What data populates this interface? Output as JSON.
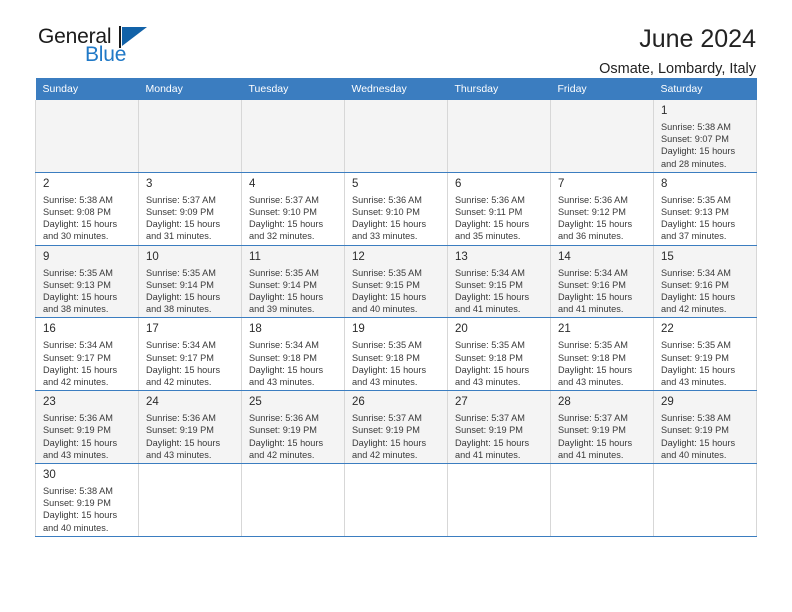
{
  "brand": {
    "name_part1": "General",
    "name_part2": "Blue",
    "flag_icon": "triangle-flag-icon",
    "accent_color": "#2079c7"
  },
  "header": {
    "title": "June 2024",
    "subtitle": "Osmate, Lombardy, Italy"
  },
  "calendar": {
    "header_bg": "#3b7dc0",
    "weekday_headers": [
      "Sunday",
      "Monday",
      "Tuesday",
      "Wednesday",
      "Thursday",
      "Friday",
      "Saturday"
    ],
    "weeks": [
      [
        {
          "day": "",
          "sunrise": "",
          "sunset": "",
          "daylight_line1": "",
          "daylight_line2": "",
          "empty": true
        },
        {
          "day": "",
          "sunrise": "",
          "sunset": "",
          "daylight_line1": "",
          "daylight_line2": "",
          "empty": true
        },
        {
          "day": "",
          "sunrise": "",
          "sunset": "",
          "daylight_line1": "",
          "daylight_line2": "",
          "empty": true
        },
        {
          "day": "",
          "sunrise": "",
          "sunset": "",
          "daylight_line1": "",
          "daylight_line2": "",
          "empty": true
        },
        {
          "day": "",
          "sunrise": "",
          "sunset": "",
          "daylight_line1": "",
          "daylight_line2": "",
          "empty": true
        },
        {
          "day": "",
          "sunrise": "",
          "sunset": "",
          "daylight_line1": "",
          "daylight_line2": "",
          "empty": true
        },
        {
          "day": "1",
          "sunrise": "Sunrise: 5:38 AM",
          "sunset": "Sunset: 9:07 PM",
          "daylight_line1": "Daylight: 15 hours",
          "daylight_line2": "and 28 minutes.",
          "empty": false
        }
      ],
      [
        {
          "day": "2",
          "sunrise": "Sunrise: 5:38 AM",
          "sunset": "Sunset: 9:08 PM",
          "daylight_line1": "Daylight: 15 hours",
          "daylight_line2": "and 30 minutes.",
          "empty": false
        },
        {
          "day": "3",
          "sunrise": "Sunrise: 5:37 AM",
          "sunset": "Sunset: 9:09 PM",
          "daylight_line1": "Daylight: 15 hours",
          "daylight_line2": "and 31 minutes.",
          "empty": false
        },
        {
          "day": "4",
          "sunrise": "Sunrise: 5:37 AM",
          "sunset": "Sunset: 9:10 PM",
          "daylight_line1": "Daylight: 15 hours",
          "daylight_line2": "and 32 minutes.",
          "empty": false
        },
        {
          "day": "5",
          "sunrise": "Sunrise: 5:36 AM",
          "sunset": "Sunset: 9:10 PM",
          "daylight_line1": "Daylight: 15 hours",
          "daylight_line2": "and 33 minutes.",
          "empty": false
        },
        {
          "day": "6",
          "sunrise": "Sunrise: 5:36 AM",
          "sunset": "Sunset: 9:11 PM",
          "daylight_line1": "Daylight: 15 hours",
          "daylight_line2": "and 35 minutes.",
          "empty": false
        },
        {
          "day": "7",
          "sunrise": "Sunrise: 5:36 AM",
          "sunset": "Sunset: 9:12 PM",
          "daylight_line1": "Daylight: 15 hours",
          "daylight_line2": "and 36 minutes.",
          "empty": false
        },
        {
          "day": "8",
          "sunrise": "Sunrise: 5:35 AM",
          "sunset": "Sunset: 9:13 PM",
          "daylight_line1": "Daylight: 15 hours",
          "daylight_line2": "and 37 minutes.",
          "empty": false
        }
      ],
      [
        {
          "day": "9",
          "sunrise": "Sunrise: 5:35 AM",
          "sunset": "Sunset: 9:13 PM",
          "daylight_line1": "Daylight: 15 hours",
          "daylight_line2": "and 38 minutes.",
          "empty": false
        },
        {
          "day": "10",
          "sunrise": "Sunrise: 5:35 AM",
          "sunset": "Sunset: 9:14 PM",
          "daylight_line1": "Daylight: 15 hours",
          "daylight_line2": "and 38 minutes.",
          "empty": false
        },
        {
          "day": "11",
          "sunrise": "Sunrise: 5:35 AM",
          "sunset": "Sunset: 9:14 PM",
          "daylight_line1": "Daylight: 15 hours",
          "daylight_line2": "and 39 minutes.",
          "empty": false
        },
        {
          "day": "12",
          "sunrise": "Sunrise: 5:35 AM",
          "sunset": "Sunset: 9:15 PM",
          "daylight_line1": "Daylight: 15 hours",
          "daylight_line2": "and 40 minutes.",
          "empty": false
        },
        {
          "day": "13",
          "sunrise": "Sunrise: 5:34 AM",
          "sunset": "Sunset: 9:15 PM",
          "daylight_line1": "Daylight: 15 hours",
          "daylight_line2": "and 41 minutes.",
          "empty": false
        },
        {
          "day": "14",
          "sunrise": "Sunrise: 5:34 AM",
          "sunset": "Sunset: 9:16 PM",
          "daylight_line1": "Daylight: 15 hours",
          "daylight_line2": "and 41 minutes.",
          "empty": false
        },
        {
          "day": "15",
          "sunrise": "Sunrise: 5:34 AM",
          "sunset": "Sunset: 9:16 PM",
          "daylight_line1": "Daylight: 15 hours",
          "daylight_line2": "and 42 minutes.",
          "empty": false
        }
      ],
      [
        {
          "day": "16",
          "sunrise": "Sunrise: 5:34 AM",
          "sunset": "Sunset: 9:17 PM",
          "daylight_line1": "Daylight: 15 hours",
          "daylight_line2": "and 42 minutes.",
          "empty": false
        },
        {
          "day": "17",
          "sunrise": "Sunrise: 5:34 AM",
          "sunset": "Sunset: 9:17 PM",
          "daylight_line1": "Daylight: 15 hours",
          "daylight_line2": "and 42 minutes.",
          "empty": false
        },
        {
          "day": "18",
          "sunrise": "Sunrise: 5:34 AM",
          "sunset": "Sunset: 9:18 PM",
          "daylight_line1": "Daylight: 15 hours",
          "daylight_line2": "and 43 minutes.",
          "empty": false
        },
        {
          "day": "19",
          "sunrise": "Sunrise: 5:35 AM",
          "sunset": "Sunset: 9:18 PM",
          "daylight_line1": "Daylight: 15 hours",
          "daylight_line2": "and 43 minutes.",
          "empty": false
        },
        {
          "day": "20",
          "sunrise": "Sunrise: 5:35 AM",
          "sunset": "Sunset: 9:18 PM",
          "daylight_line1": "Daylight: 15 hours",
          "daylight_line2": "and 43 minutes.",
          "empty": false
        },
        {
          "day": "21",
          "sunrise": "Sunrise: 5:35 AM",
          "sunset": "Sunset: 9:18 PM",
          "daylight_line1": "Daylight: 15 hours",
          "daylight_line2": "and 43 minutes.",
          "empty": false
        },
        {
          "day": "22",
          "sunrise": "Sunrise: 5:35 AM",
          "sunset": "Sunset: 9:19 PM",
          "daylight_line1": "Daylight: 15 hours",
          "daylight_line2": "and 43 minutes.",
          "empty": false
        }
      ],
      [
        {
          "day": "23",
          "sunrise": "Sunrise: 5:36 AM",
          "sunset": "Sunset: 9:19 PM",
          "daylight_line1": "Daylight: 15 hours",
          "daylight_line2": "and 43 minutes.",
          "empty": false
        },
        {
          "day": "24",
          "sunrise": "Sunrise: 5:36 AM",
          "sunset": "Sunset: 9:19 PM",
          "daylight_line1": "Daylight: 15 hours",
          "daylight_line2": "and 43 minutes.",
          "empty": false
        },
        {
          "day": "25",
          "sunrise": "Sunrise: 5:36 AM",
          "sunset": "Sunset: 9:19 PM",
          "daylight_line1": "Daylight: 15 hours",
          "daylight_line2": "and 42 minutes.",
          "empty": false
        },
        {
          "day": "26",
          "sunrise": "Sunrise: 5:37 AM",
          "sunset": "Sunset: 9:19 PM",
          "daylight_line1": "Daylight: 15 hours",
          "daylight_line2": "and 42 minutes.",
          "empty": false
        },
        {
          "day": "27",
          "sunrise": "Sunrise: 5:37 AM",
          "sunset": "Sunset: 9:19 PM",
          "daylight_line1": "Daylight: 15 hours",
          "daylight_line2": "and 41 minutes.",
          "empty": false
        },
        {
          "day": "28",
          "sunrise": "Sunrise: 5:37 AM",
          "sunset": "Sunset: 9:19 PM",
          "daylight_line1": "Daylight: 15 hours",
          "daylight_line2": "and 41 minutes.",
          "empty": false
        },
        {
          "day": "29",
          "sunrise": "Sunrise: 5:38 AM",
          "sunset": "Sunset: 9:19 PM",
          "daylight_line1": "Daylight: 15 hours",
          "daylight_line2": "and 40 minutes.",
          "empty": false
        }
      ],
      [
        {
          "day": "30",
          "sunrise": "Sunrise: 5:38 AM",
          "sunset": "Sunset: 9:19 PM",
          "daylight_line1": "Daylight: 15 hours",
          "daylight_line2": "and 40 minutes.",
          "empty": false
        },
        {
          "day": "",
          "sunrise": "",
          "sunset": "",
          "daylight_line1": "",
          "daylight_line2": "",
          "empty": true
        },
        {
          "day": "",
          "sunrise": "",
          "sunset": "",
          "daylight_line1": "",
          "daylight_line2": "",
          "empty": true
        },
        {
          "day": "",
          "sunrise": "",
          "sunset": "",
          "daylight_line1": "",
          "daylight_line2": "",
          "empty": true
        },
        {
          "day": "",
          "sunrise": "",
          "sunset": "",
          "daylight_line1": "",
          "daylight_line2": "",
          "empty": true
        },
        {
          "day": "",
          "sunrise": "",
          "sunset": "",
          "daylight_line1": "",
          "daylight_line2": "",
          "empty": true
        },
        {
          "day": "",
          "sunrise": "",
          "sunset": "",
          "daylight_line1": "",
          "daylight_line2": "",
          "empty": true
        }
      ]
    ]
  }
}
